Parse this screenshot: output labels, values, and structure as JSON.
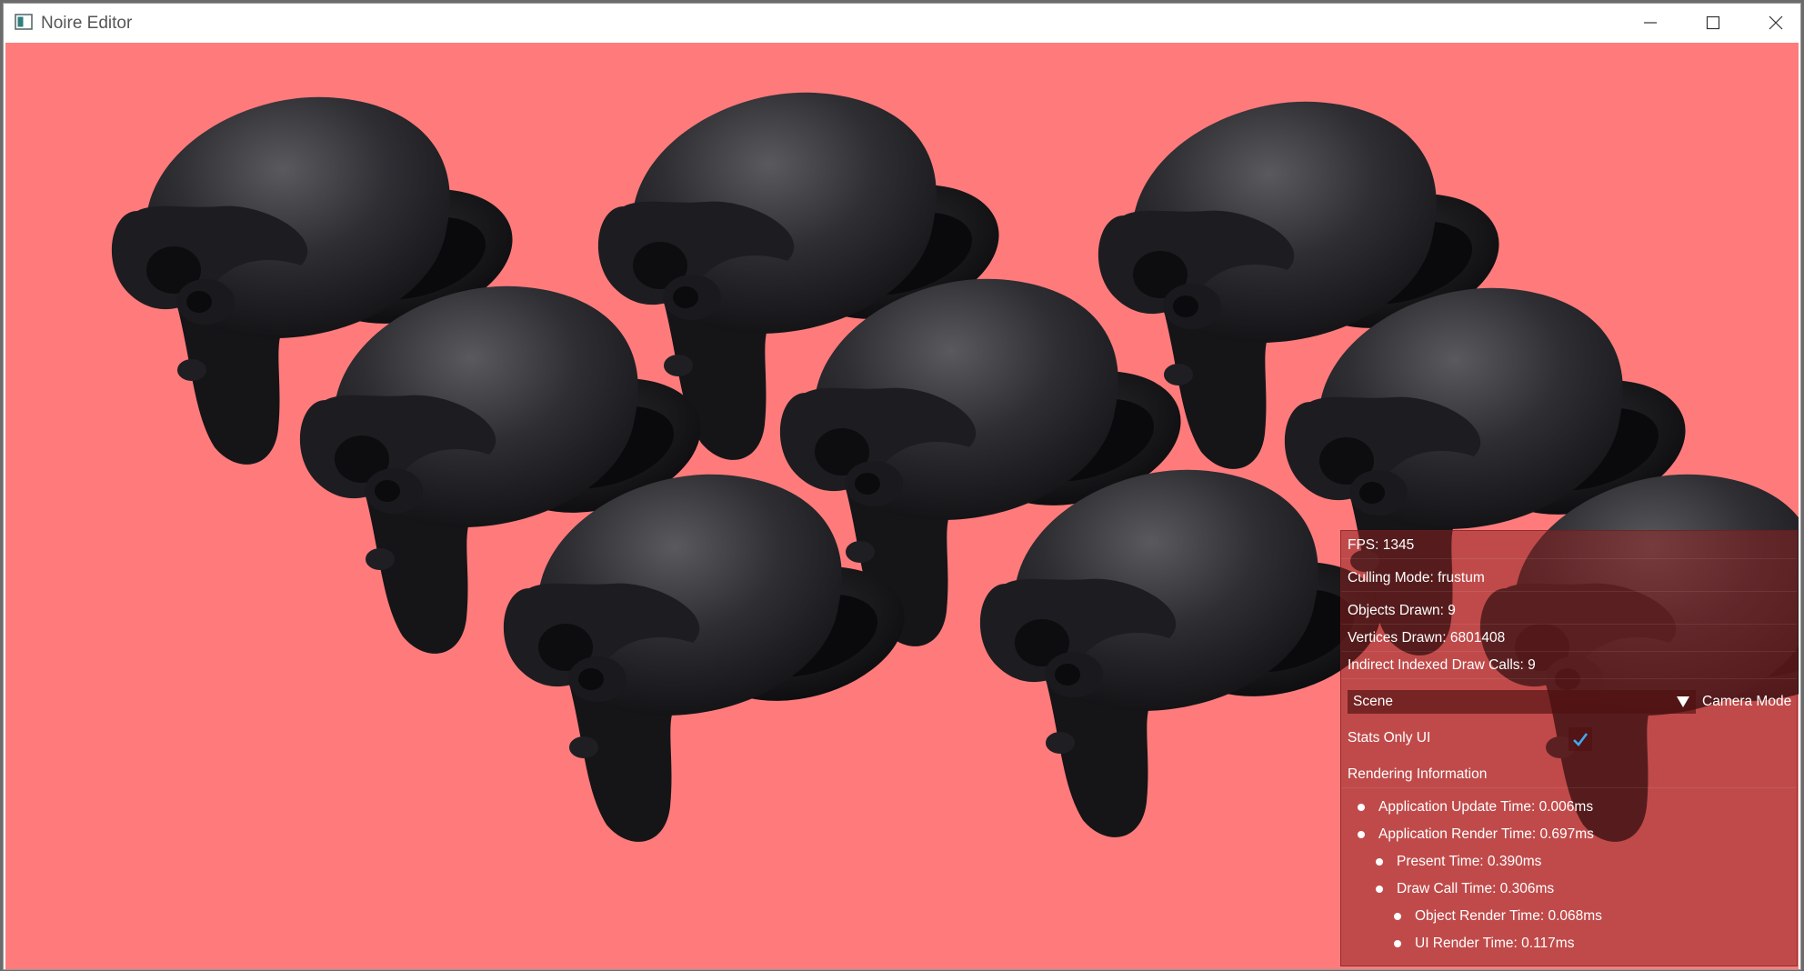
{
  "window": {
    "title": "Noire Editor"
  },
  "colors": {
    "viewport_bg": "#ff7b7b",
    "checkmark": "#3fa9f5",
    "overlay": "#8c2323"
  },
  "icons": {
    "app": "app-window-icon",
    "minimize": "minimize-icon",
    "maximize": "maximize-icon",
    "close": "close-icon",
    "dropdown": "triangle-down-icon",
    "check": "checkmark-icon",
    "bullet": "bullet-icon"
  },
  "stats": {
    "fps": "FPS: 1345",
    "culling_mode": "Culling Mode: frustum",
    "objects_drawn": "Objects Drawn: 9",
    "vertices_drawn": "Vertices Drawn: 6801408",
    "draw_calls": "Indirect Indexed Draw Calls: 9"
  },
  "camera": {
    "selected": "Scene",
    "label": "Camera Mode"
  },
  "stats_only": {
    "label": "Stats Only UI",
    "checked": true
  },
  "rendering": {
    "header": "Rendering Information",
    "app_update": "Application Update Time: 0.006ms",
    "app_render": "Application Render Time: 0.697ms",
    "present": "Present Time: 0.390ms",
    "draw_call": "Draw Call Time: 0.306ms",
    "object_render": "Object Render Time: 0.068ms",
    "ui_render": "UI Render Time: 0.117ms"
  }
}
